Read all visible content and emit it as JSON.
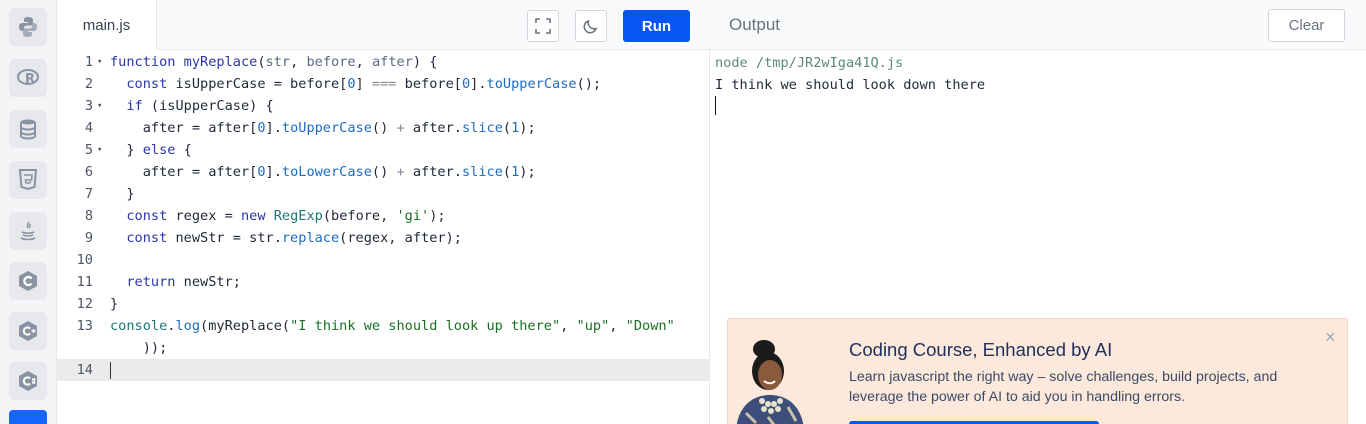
{
  "sidebar": {
    "items": [
      {
        "icon": "python-icon"
      },
      {
        "icon": "r-icon"
      },
      {
        "icon": "database-icon"
      },
      {
        "icon": "html5-icon"
      },
      {
        "icon": "java-icon"
      },
      {
        "icon": "c-icon"
      },
      {
        "icon": "cpp-icon"
      },
      {
        "icon": "csharp-icon"
      },
      {
        "icon": "javascript-icon"
      }
    ]
  },
  "editor": {
    "tab_label": "main.js",
    "run_label": "Run",
    "fullscreen_icon": "fullscreen-icon",
    "theme_icon": "moon-icon",
    "line_numbers": [
      "1",
      "2",
      "3",
      "4",
      "5",
      "6",
      "7",
      "8",
      "9",
      "10",
      "11",
      "12",
      "13",
      "",
      "14"
    ],
    "code_lines": [
      "function myReplace(str, before, after) {",
      "  const isUpperCase = before[0] === before[0].toUpperCase();",
      "  if (isUpperCase) {",
      "    after = after[0].toUpperCase() + after.slice(1);",
      "  } else {",
      "    after = after[0].toLowerCase() + after.slice(1);",
      "  }",
      "  const regex = new RegExp(before, 'gi');",
      "  const newStr = str.replace(regex, after);",
      "",
      "  return newStr;",
      "}",
      "console.log(myReplace(\"I think we should look up there\", \"up\", \"Down\"",
      "    ));",
      ""
    ]
  },
  "output": {
    "title": "Output",
    "clear_label": "Clear",
    "command": "node /tmp/JR2wIga41Q.js",
    "result": "I think we should look down there"
  },
  "promo": {
    "title": "Coding Course, Enhanced by AI",
    "text": "Learn javascript the right way – solve challenges, build projects, and leverage the power of AI to aid you in handling errors.",
    "close": "×"
  },
  "colors": {
    "accent": "#0556f3",
    "promo_bg": "#fde9dc"
  }
}
